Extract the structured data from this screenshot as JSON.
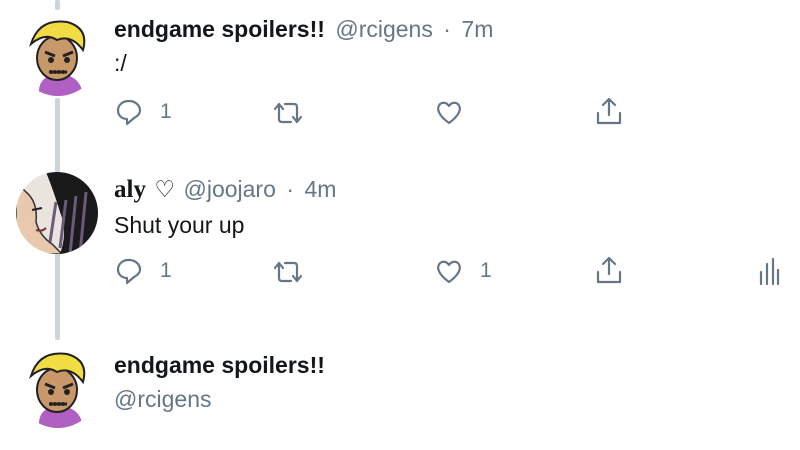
{
  "tweets": [
    {
      "display_name": "endgame spoilers!!",
      "handle": "@rcigens",
      "separator": "·",
      "time": "7m",
      "text": ":/",
      "reply_count": "1",
      "retweet_count": "",
      "like_count": ""
    },
    {
      "display_name": "aly",
      "name_heart": "♡",
      "handle": "@joojaro",
      "separator": "·",
      "time": "4m",
      "text": "Shut your up",
      "reply_count": "1",
      "retweet_count": "",
      "like_count": "1"
    },
    {
      "display_name": "endgame spoilers!!",
      "handle": "@rcigens"
    }
  ],
  "icons": {
    "reply": "reply-icon",
    "retweet": "retweet-icon",
    "like": "heart-icon",
    "share": "share-icon",
    "analytics": "analytics-icon"
  },
  "colors": {
    "icon_gray": "#657786",
    "thread_line": "#cdd5dc",
    "avatar_yellow": "#f2dc43",
    "avatar_purple": "#b05fc2"
  }
}
